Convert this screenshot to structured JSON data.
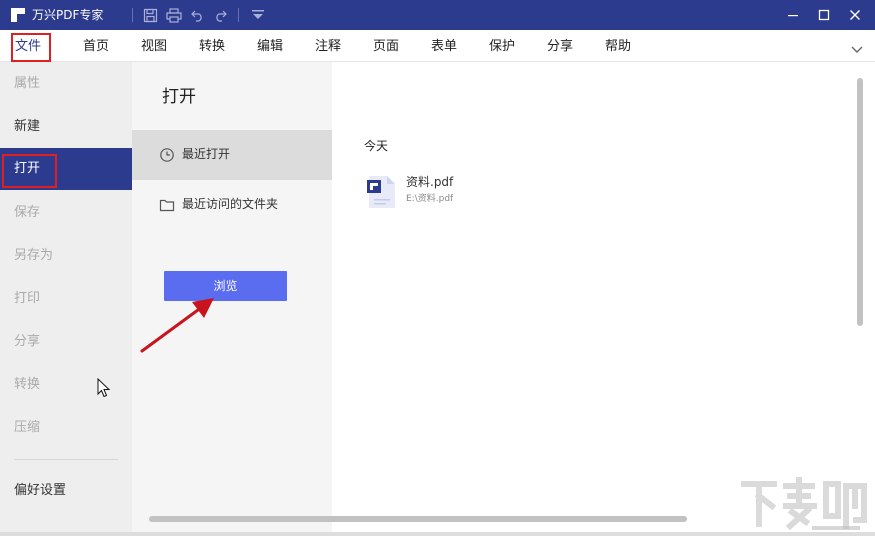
{
  "titlebar": {
    "title": "万兴PDF专家",
    "icons": [
      "save-icon",
      "print-icon",
      "undo-icon",
      "redo-icon",
      "dropdown-icon"
    ],
    "window_controls": [
      "minimize-icon",
      "maximize-icon",
      "close-icon"
    ]
  },
  "menu": {
    "items": [
      "文件",
      "首页",
      "视图",
      "转换",
      "编辑",
      "注释",
      "页面",
      "表单",
      "保护",
      "分享",
      "帮助"
    ],
    "active_index": 0
  },
  "sidebar": {
    "items": [
      {
        "label": "属性",
        "enabled": false
      },
      {
        "label": "新建",
        "enabled": true
      },
      {
        "label": "打开",
        "enabled": true,
        "selected": true
      },
      {
        "label": "保存",
        "enabled": false
      },
      {
        "label": "另存为",
        "enabled": false
      },
      {
        "label": "打印",
        "enabled": false
      },
      {
        "label": "分享",
        "enabled": false
      },
      {
        "label": "转换",
        "enabled": false
      },
      {
        "label": "压缩",
        "enabled": false
      }
    ],
    "preferences": "偏好设置"
  },
  "open_panel": {
    "title": "打开",
    "nav": [
      {
        "label": "最近打开",
        "icon": "clock-icon",
        "active": true
      },
      {
        "label": "最近访问的文件夹",
        "icon": "folder-icon",
        "active": false
      }
    ],
    "browse_label": "浏览"
  },
  "recent": {
    "section": "今天",
    "files": [
      {
        "name": "资料.pdf",
        "path": "E:\\资料.pdf",
        "icon": "pdf-file-icon"
      }
    ]
  },
  "watermark": {
    "text": "下载吧"
  },
  "colors": {
    "titlebar": "#2d3b8e",
    "selected": "#2d3b8e",
    "button": "#5a6cf0",
    "highlight": "#e02020",
    "arrow": "#c8141e"
  }
}
